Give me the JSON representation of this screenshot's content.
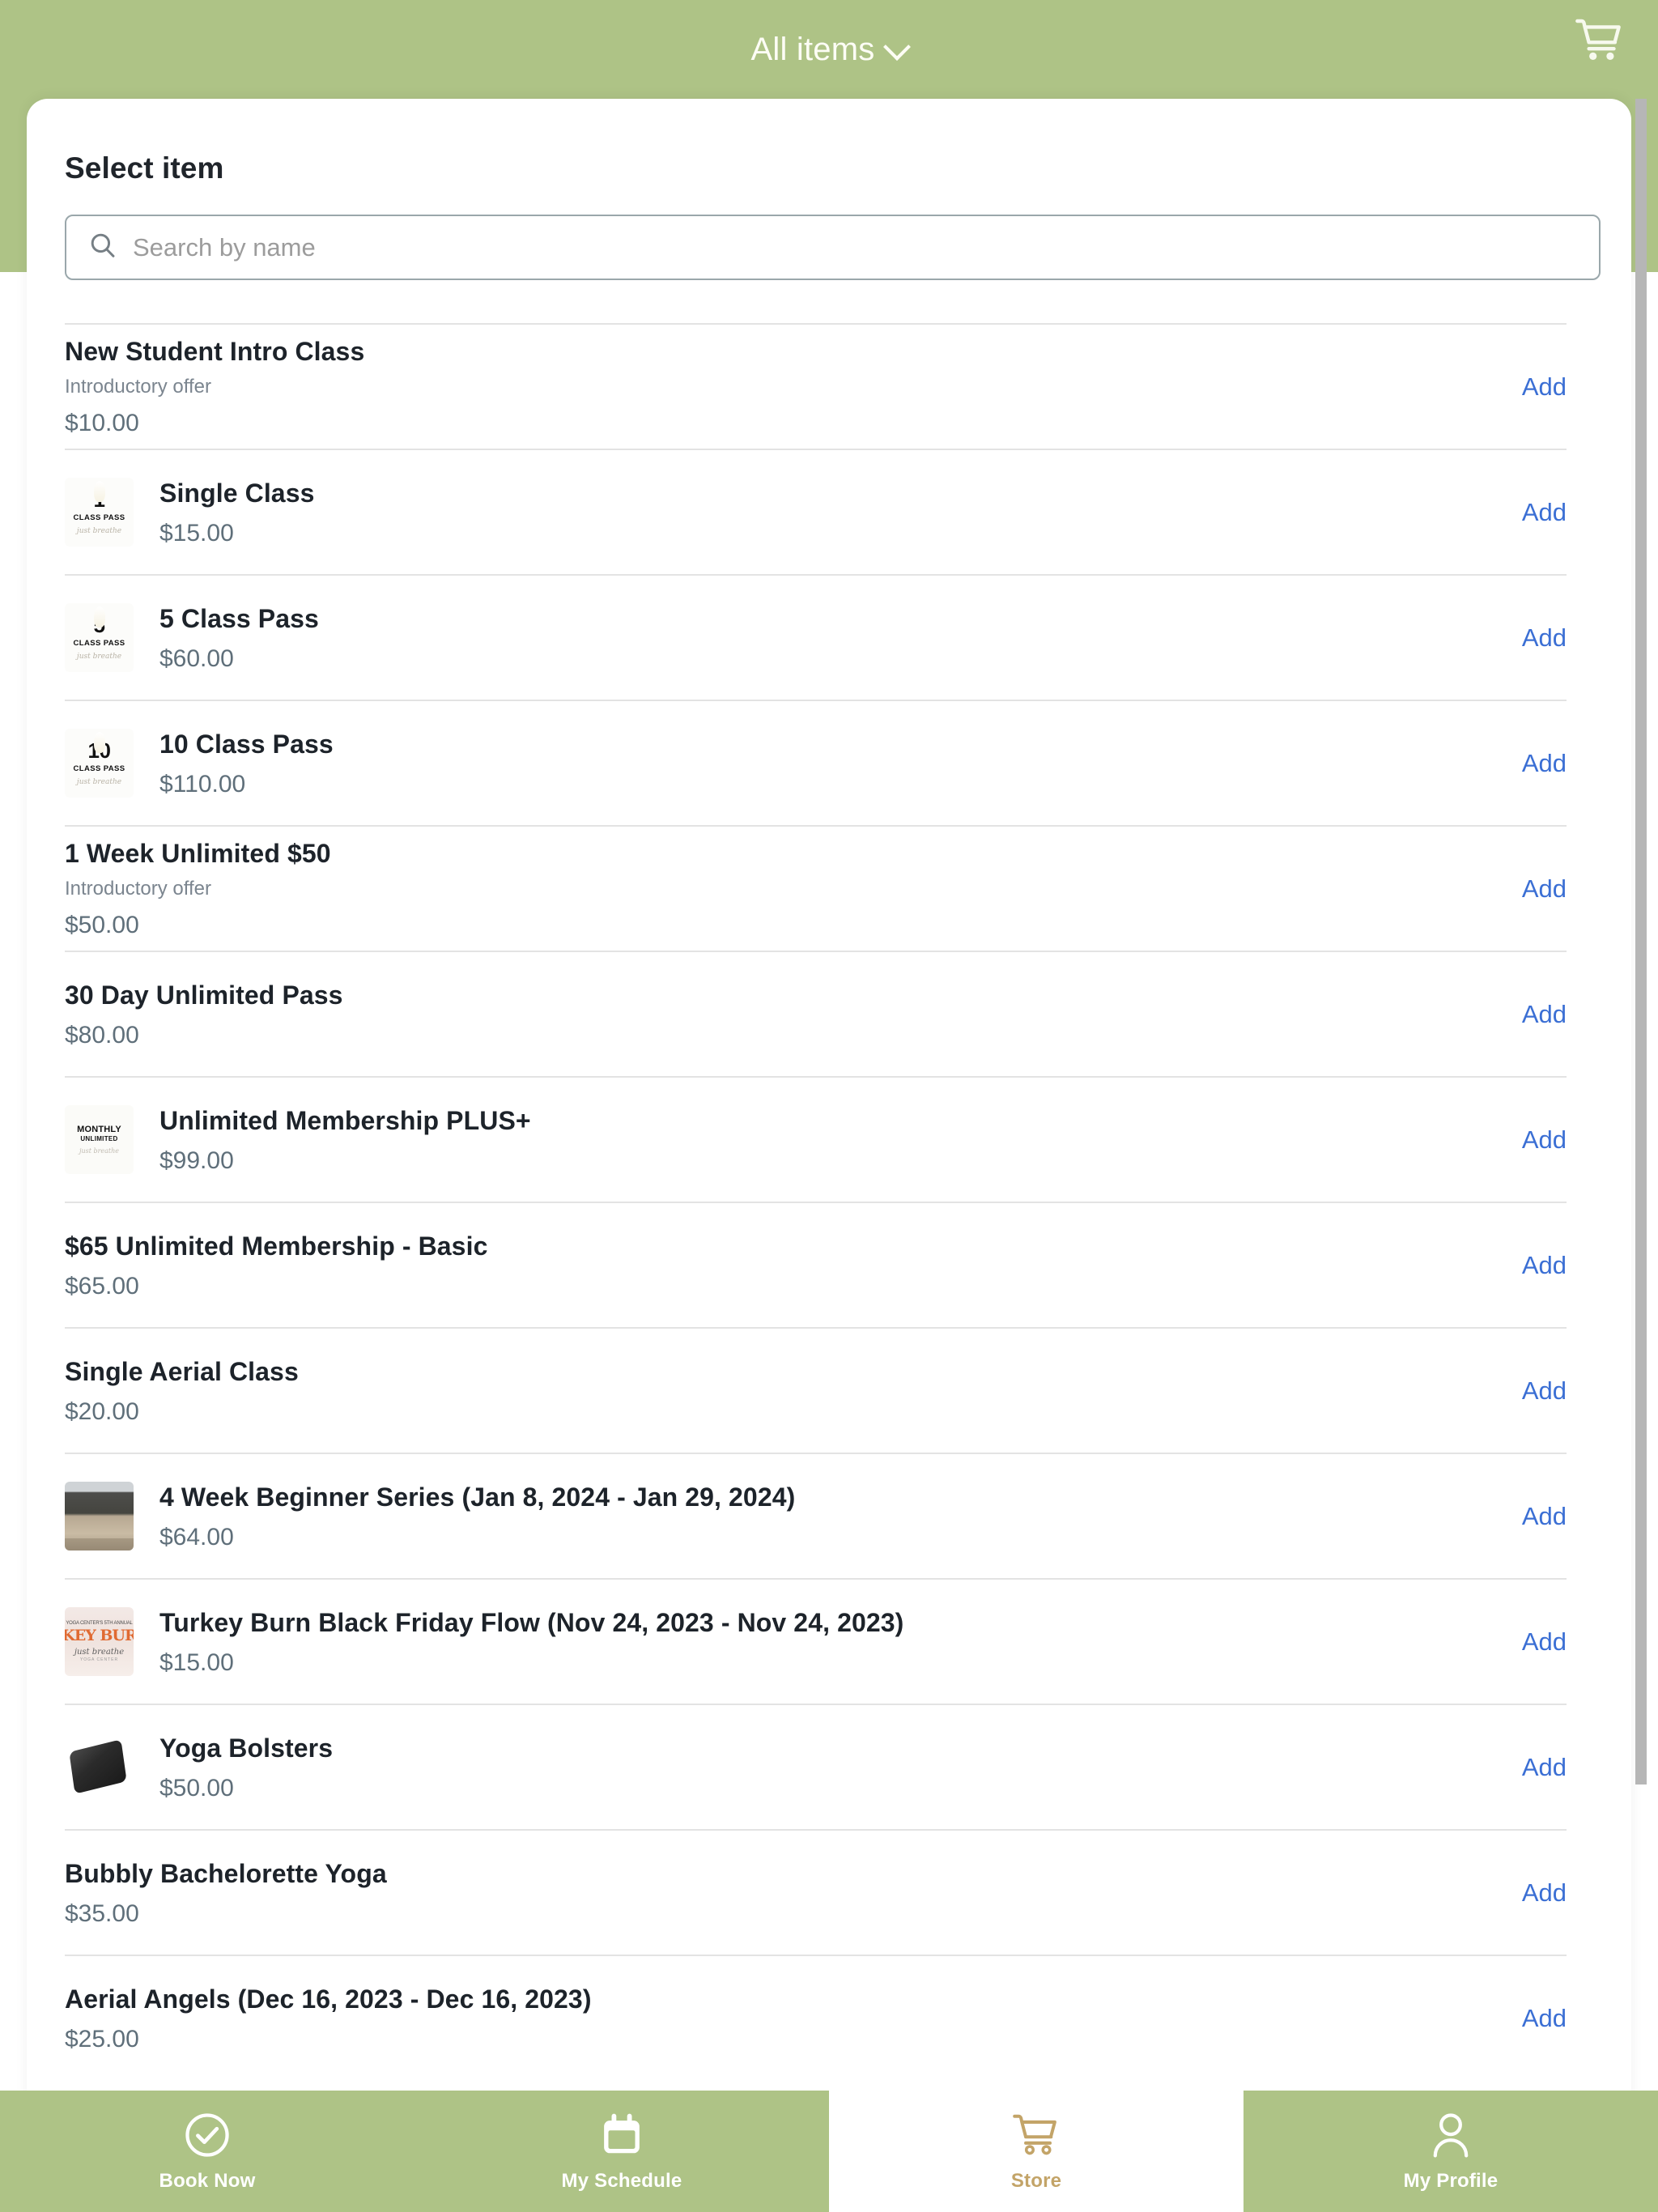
{
  "header": {
    "filter_label": "All items",
    "chevron_icon": "chevron-down-icon",
    "cart_icon": "shopping-cart-icon"
  },
  "page": {
    "title": "Select item"
  },
  "search": {
    "icon": "search-icon",
    "placeholder": "Search by name",
    "value": ""
  },
  "colors": {
    "brand_green": "#aec386",
    "add_link_blue": "#3b6fd4",
    "active_tab_gold": "#c3a468",
    "price_gray": "#5f6f7a",
    "subtitle_gray": "#7b858f"
  },
  "add_label": "Add",
  "items": [
    {
      "name": "New Student Intro Class",
      "subtitle": "Introductory offer",
      "price": "$10.00",
      "thumb": "none"
    },
    {
      "name": "Single Class",
      "subtitle": "",
      "price": "$15.00",
      "thumb": "class-pass-1",
      "thumb_text": {
        "num": "1",
        "caption": "CLASS PASS",
        "script": "just breathe"
      }
    },
    {
      "name": "5 Class Pass",
      "subtitle": "",
      "price": "$60.00",
      "thumb": "class-pass-5",
      "thumb_text": {
        "num": "5",
        "caption": "CLASS PASS",
        "script": "just breathe"
      }
    },
    {
      "name": "10 Class Pass",
      "subtitle": "",
      "price": "$110.00",
      "thumb": "class-pass-10",
      "thumb_text": {
        "num": "10",
        "caption": "CLASS PASS",
        "script": "just breathe"
      }
    },
    {
      "name": "1 Week Unlimited $50",
      "subtitle": "Introductory offer",
      "price": "$50.00",
      "thumb": "none"
    },
    {
      "name": "30 Day Unlimited Pass",
      "subtitle": "",
      "price": "$80.00",
      "thumb": "none"
    },
    {
      "name": "Unlimited Membership PLUS+",
      "subtitle": "",
      "price": "$99.00",
      "thumb": "monthly-unlimited",
      "thumb_text": {
        "l1": "MONTHLY",
        "l2": "UNLIMITED",
        "l3": "just breathe"
      }
    },
    {
      "name": "$65 Unlimited Membership - Basic",
      "subtitle": "",
      "price": "$65.00",
      "thumb": "none"
    },
    {
      "name": "Single Aerial Class",
      "subtitle": "",
      "price": "$20.00",
      "thumb": "none"
    },
    {
      "name": "4 Week Beginner Series (Jan 8, 2024 - Jan 29, 2024)",
      "subtitle": "",
      "price": "$64.00",
      "thumb": "beach-photo"
    },
    {
      "name": "Turkey Burn Black Friday Flow (Nov 24, 2023 - Nov 24, 2023)",
      "subtitle": "",
      "price": "$15.00",
      "thumb": "turkey-burn-poster",
      "thumb_text": {
        "t1": "YOGA CENTER'S 5TH ANNUAL",
        "t2": "KEY BUR",
        "t3": "just breathe",
        "t4": "YOGA CENTER"
      }
    },
    {
      "name": "Yoga Bolsters",
      "subtitle": "",
      "price": "$50.00",
      "thumb": "bolster-photo"
    },
    {
      "name": "Bubbly Bachelorette Yoga",
      "subtitle": "",
      "price": "$35.00",
      "thumb": "none"
    },
    {
      "name": "Aerial Angels (Dec 16, 2023 - Dec 16, 2023)",
      "subtitle": "",
      "price": "$25.00",
      "thumb": "none"
    }
  ],
  "tabbar": [
    {
      "label": "Book Now",
      "icon": "check-circle-icon",
      "active": false
    },
    {
      "label": "My Schedule",
      "icon": "calendar-icon",
      "active": false
    },
    {
      "label": "Store",
      "icon": "shopping-cart-icon",
      "active": true
    },
    {
      "label": "My Profile",
      "icon": "person-icon",
      "active": false
    }
  ]
}
